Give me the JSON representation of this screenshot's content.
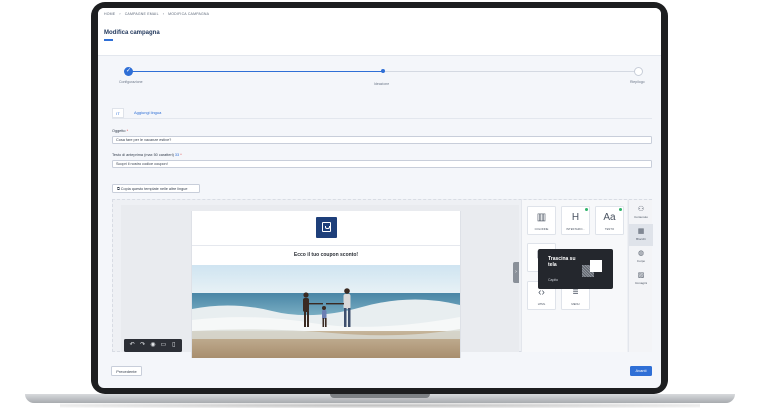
{
  "breadcrumb": [
    "HOME",
    "CAMPAGNE EMAIL",
    "MODIFICA CAMPAGNA"
  ],
  "page_title": "Modifica campagna",
  "stepper": {
    "steps": [
      {
        "label": "Configurazione",
        "state": "done"
      },
      {
        "label": "Ideazione",
        "state": "current"
      },
      {
        "label": "Riepilogo",
        "state": "pending"
      }
    ],
    "check_glyph": "✓"
  },
  "tabs": {
    "language": "IT",
    "add_language": "Aggiungi lingua"
  },
  "form": {
    "subject_label": "Oggetto",
    "subject_required": "*",
    "subject_value": "Cosa fare per le vacanze estive?",
    "preview_label": "Testo di anteprima (max 50 caratteri)",
    "preview_count": "33",
    "preview_required": "*",
    "preview_value": "Scopri il nostro codice coupon!"
  },
  "copy_button": "Copia questo template nelle altre lingue",
  "email": {
    "headline": "Ecco il tuo coupon sconto!"
  },
  "toolbar_icons": [
    "undo-icon",
    "redo-icon",
    "eye-icon",
    "desktop-icon",
    "mobile-icon"
  ],
  "blocks": [
    {
      "label": "COLONNE",
      "icon": "columns-icon",
      "glyph": "▥"
    },
    {
      "label": "INTESTAZIO...",
      "icon": "heading-icon",
      "glyph": "H"
    },
    {
      "label": "TESTO",
      "icon": "text-icon",
      "glyph": "Aa"
    },
    {
      "label": "IM...",
      "icon": "image-icon",
      "glyph": "▣"
    },
    {
      "label": "HTML",
      "icon": "code-icon",
      "glyph": "‹›"
    },
    {
      "label": "MENU",
      "icon": "menu-icon",
      "glyph": "≡"
    }
  ],
  "tooltip": {
    "title": "Trascina su tela",
    "hint": "Capito"
  },
  "rail": [
    {
      "label": "Contenuto",
      "icon": "shapes-icon",
      "glyph": "⚇"
    },
    {
      "label": "Blocchi",
      "icon": "grid-icon",
      "glyph": "▦"
    },
    {
      "label": "Corpo",
      "icon": "palette-icon",
      "glyph": "◍"
    },
    {
      "label": "Immagini",
      "icon": "images-icon",
      "glyph": "▨"
    }
  ],
  "footer": {
    "prev": "Precedente",
    "next": "Avanti"
  },
  "colors": {
    "accent": "#2f6fd6",
    "title": "#243a5e",
    "dark": "#24272d"
  }
}
